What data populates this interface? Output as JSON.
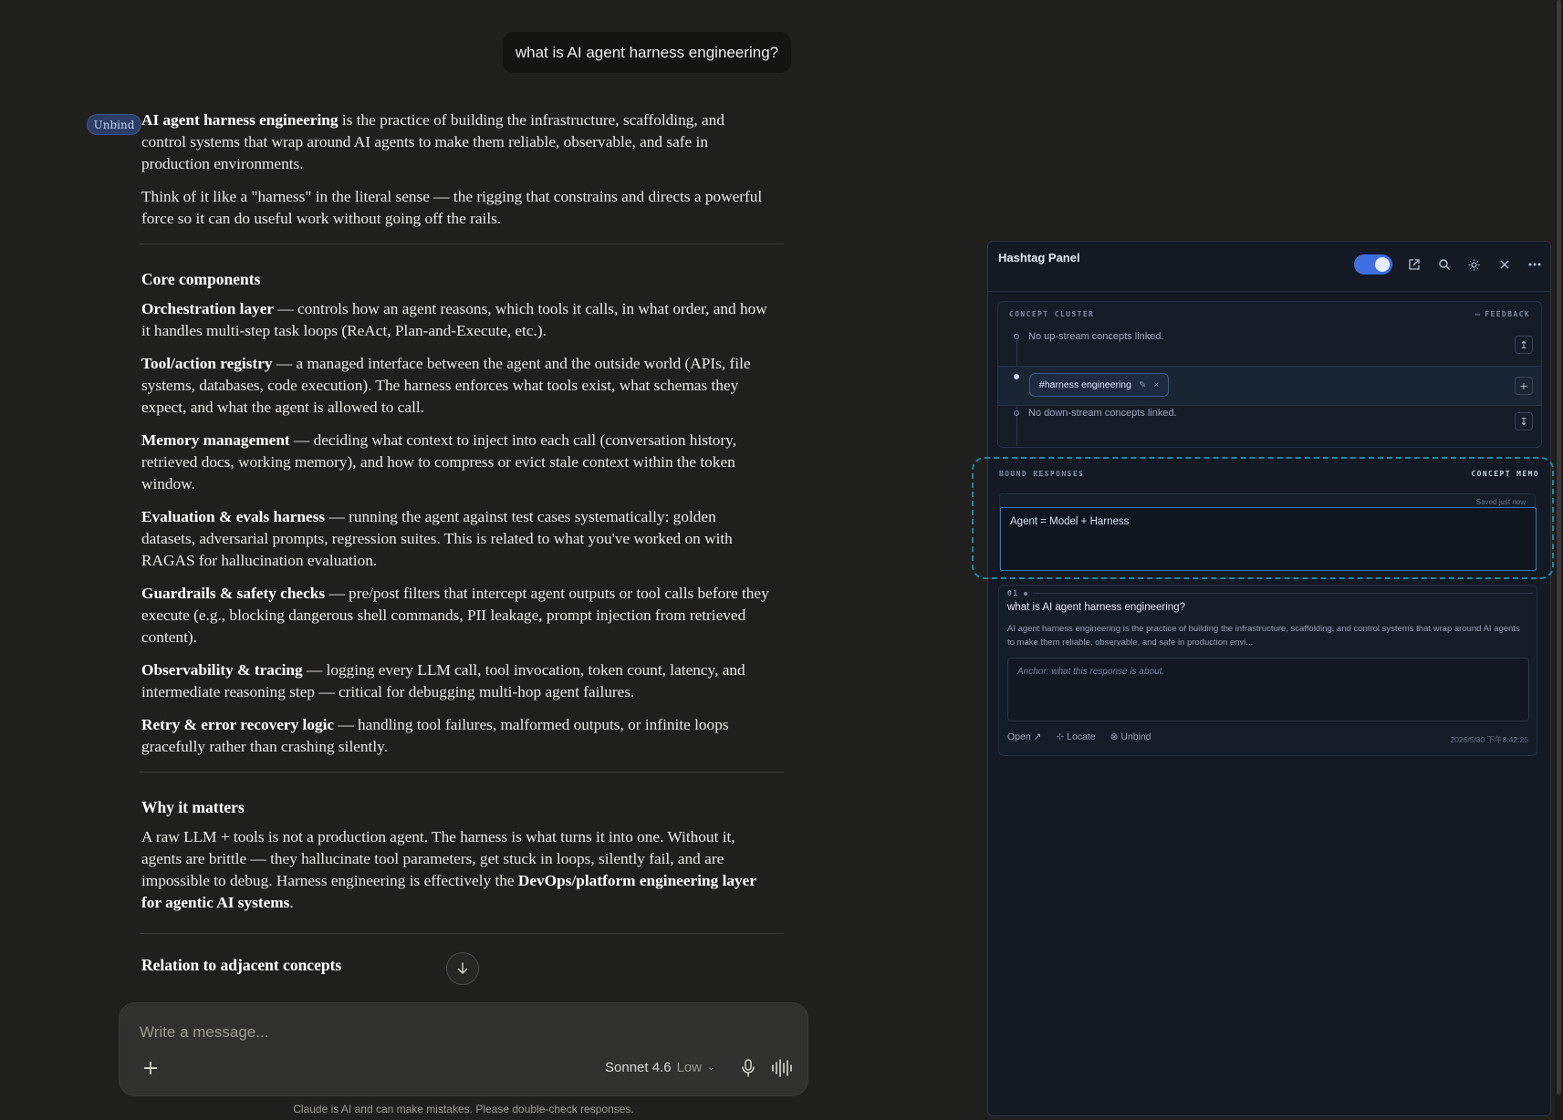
{
  "chat": {
    "user_message": "what is AI agent harness engineering?",
    "unbind_label": "Unbind",
    "intro_lead": "AI agent harness engineering",
    "intro_rest": " is the practice of building the infrastructure, scaffolding, and control systems that wrap around AI agents to make them reliable, observable, and safe in production environments.",
    "analogy": "Think of it like a \"harness\" in the literal sense — the rigging that constrains and directs a powerful force so it can do useful work without going off the rails.",
    "core_heading": "Core components",
    "components": [
      {
        "term": "Orchestration layer",
        "desc": " — controls how an agent reasons, which tools it calls, in what order, and how it handles multi-step task loops (ReAct, Plan-and-Execute, etc.)."
      },
      {
        "term": "Tool/action registry",
        "desc": " — a managed interface between the agent and the outside world (APIs, file systems, databases, code execution). The harness enforces what tools exist, what schemas they expect, and what the agent is allowed to call."
      },
      {
        "term": "Memory management",
        "desc": " — deciding what context to inject into each call (conversation history, retrieved docs, working memory), and how to compress or evict stale context within the token window."
      },
      {
        "term": "Evaluation & evals harness",
        "desc": " — running the agent against test cases systematically: golden datasets, adversarial prompts, regression suites. This is related to what you've worked on with RAGAS for hallucination evaluation."
      },
      {
        "term": "Guardrails & safety checks",
        "desc": " — pre/post filters that intercept agent outputs or tool calls before they execute (e.g., blocking dangerous shell commands, PII leakage, prompt injection from retrieved content)."
      },
      {
        "term": "Observability & tracing",
        "desc": " — logging every LLM call, tool invocation, token count, latency, and intermediate reasoning step — critical for debugging multi-hop agent failures."
      },
      {
        "term": "Retry & error recovery logic",
        "desc": " — handling tool failures, malformed outputs, or infinite loops gracefully rather than crashing silently."
      }
    ],
    "why_heading": "Why it matters",
    "why_text": "A raw LLM + tools is not a production agent. The harness is what turns it into one. Without it, agents are brittle — they hallucinate tool parameters, get stuck in loops, silently fail, and are impossible to debug. Harness engineering is effectively the ",
    "why_bold": "DevOps/platform engineering layer for agentic AI systems",
    "why_end": ".",
    "relation_heading": "Relation to adjacent concepts"
  },
  "composer": {
    "placeholder": "Write a message...",
    "model": "Sonnet 4.6",
    "effort": "Low",
    "disclaimer": "Claude is AI and can make mistakes. Please double-check responses."
  },
  "panel": {
    "title": "Hashtag Panel",
    "toggle_on": true,
    "cluster_label": "CONCEPT CLUSTER",
    "feedback_label": "FEEDBACK",
    "upstream_text": "No up-stream concepts linked.",
    "tag": "#harness engineering",
    "downstream_text": "No down-stream concepts linked.",
    "bound_label": "BOUND RESPONSES",
    "memo_label": "CONCEPT MEMO",
    "saved_text": "Saved just now",
    "memo_value": "Agent = Model + Harness",
    "response": {
      "index": "01",
      "question": "what is AI agent harness engineering?",
      "snippet": "AI agent harness engineering is the practice of building the infrastructure, scaffolding, and control systems that wrap around AI agents to make them reliable, observable, and safe in production envi...",
      "anchor_placeholder": "Anchor: what this response is about.",
      "open_label": "Open ↗",
      "locate_label": "⊹ Locate",
      "unbind_label": "⊗ Unbind",
      "timestamp": "2026/5/30 下午8:42:25"
    }
  },
  "colors": {
    "accent": "#3d6fe0",
    "highlight": "#1b8aa6",
    "chat_bg": "#1f1f1e",
    "panel_bg": "#131a24"
  }
}
